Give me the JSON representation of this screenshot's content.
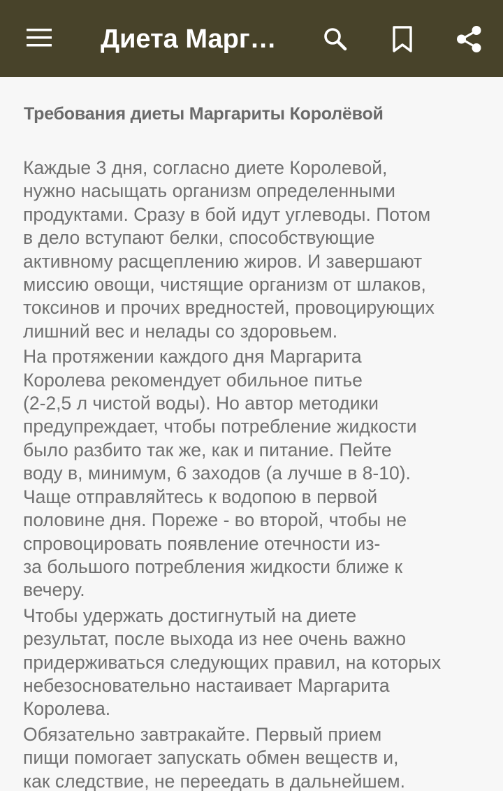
{
  "app_bar": {
    "title": "Диета Маргаритты Королёвой",
    "icons": {
      "menu": "hamburger-menu-icon",
      "search": "search-icon",
      "bookmark": "bookmark-icon",
      "share": "share-icon"
    },
    "colors": {
      "background": "#48432a",
      "foreground": "#ffffff"
    }
  },
  "article": {
    "heading": "Требования диеты Маргариты Королёвой",
    "paragraphs": [
      {
        "lines": [
          "Каждые 3 дня, согласно диете Королевой,",
          "нужно насыщать организм определенными",
          "продуктами. Сразу в бой идут углеводы. Потом",
          "в дело вступают белки, способствующие",
          "активному расщеплению жиров. И завершают",
          "миссию овощи, чистящие организм от шлаков,",
          "токсинов и прочих вредностей, провоцирующих",
          "лишний вес и нелады со здоровьем."
        ]
      },
      {
        "lines": [
          "На протяжении каждого дня Маргарита",
          "Королева рекомендует обильное питье",
          "(2-2,5 л чистой воды). Но автор методики",
          "предупреждает, чтобы потребление жидкости",
          "было разбито так же, как и питание. Пейте",
          "воду в, минимум, 6 заходов (а лучше в 8-10).",
          "Чаще отправляйтесь к водопою в первой",
          "половине дня. Пореже - во второй, чтобы не",
          "спровоцировать появление отечности из-",
          "за большого потребления жидкости ближе к",
          "вечеру."
        ]
      },
      {
        "lines": [
          "Чтобы удержать достигнутый на диете",
          "результат, после выхода из нее очень важно",
          "придерживаться следующих правил, на которых",
          "небезосновательно настаивает Маргарита",
          "Королева."
        ]
      },
      {
        "lines": [
          "Обязательно завтракайте. Первый прием",
          "пищи помогает запускать обмен веществ и,",
          "как следствие, не переедать в дальнейшем."
        ]
      }
    ]
  }
}
